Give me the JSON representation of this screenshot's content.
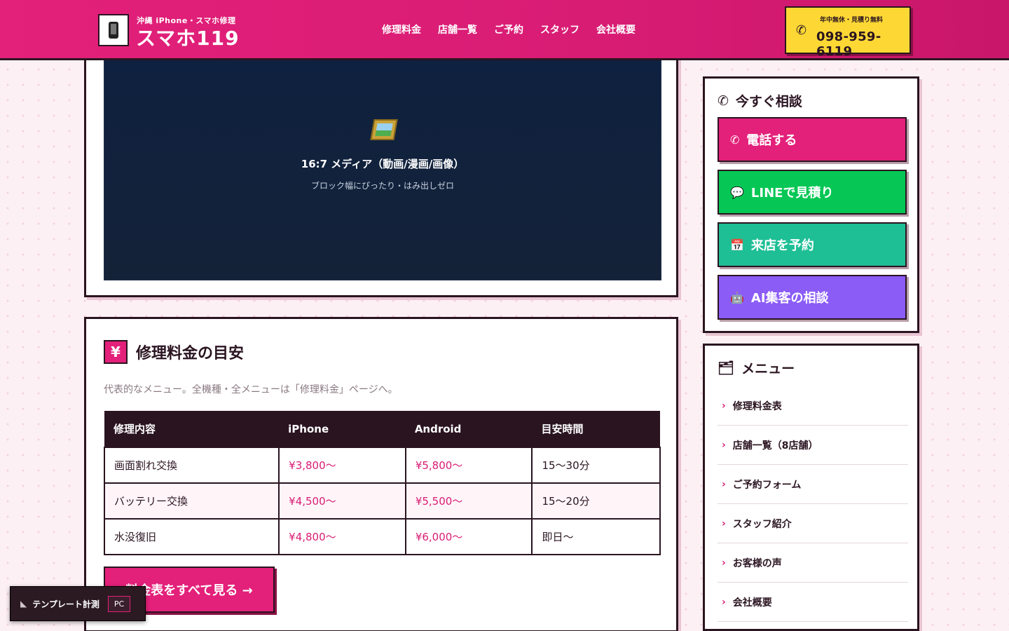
{
  "header": {
    "logo_sub": "沖縄 iPhone・スマホ修理",
    "logo_title": "スマホ119",
    "nav": [
      "修理料金",
      "店舗一覧",
      "ご予約",
      "スタッフ",
      "会社概要"
    ],
    "cta_sub": "年中無休・見積り無料",
    "cta_phone": "098-959-6119"
  },
  "media": {
    "title": "16:7 メディア（動画/漫画/画像）",
    "subtitle": "ブロック幅にぴったり・はみ出しゼロ"
  },
  "price": {
    "icon": "¥",
    "title": "修理料金の目安",
    "description": "代表的なメニュー。全機種・全メニューは「修理料金」ページへ。",
    "columns": [
      "修理内容",
      "iPhone",
      "Android",
      "目安時間"
    ],
    "rows": [
      [
        "画面割れ交換",
        "¥3,800〜",
        "¥5,800〜",
        "15〜30分"
      ],
      [
        "バッテリー交換",
        "¥4,500〜",
        "¥5,500〜",
        "15〜20分"
      ],
      [
        "水没復旧",
        "¥4,800〜",
        "¥6,000〜",
        "即日〜"
      ]
    ],
    "more_button": "料金表をすべて見る →"
  },
  "consult": {
    "title": "今すぐ相談",
    "buttons": [
      "電話する",
      "LINEで見積り",
      "来店を予約",
      "AI集客の相談"
    ]
  },
  "menu": {
    "title": "メニュー",
    "items": [
      "修理料金表",
      "店舗一覧（8店舗）",
      "ご予約フォーム",
      "スタッフ紹介",
      "お客様の声",
      "会社概要"
    ]
  },
  "measure": {
    "label": "テンプレート計測",
    "mode": "PC"
  },
  "colors": {
    "brand_pink": "#e3207a",
    "cta_yellow": "#fdd835",
    "line_green": "#06c755",
    "reserve_teal": "#1fbf95",
    "ai_purple": "#8b5cf6",
    "ink": "#2a1420"
  }
}
